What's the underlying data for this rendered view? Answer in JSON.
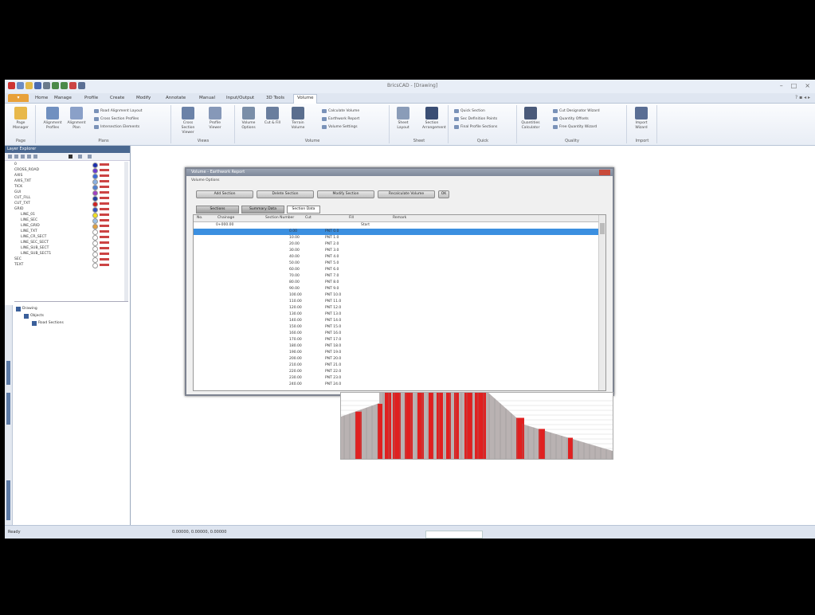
{
  "window": {
    "title": "BricsCAD - [Drawing]"
  },
  "ribbon_tabs": [
    {
      "label": "Home"
    },
    {
      "label": "Manage"
    },
    {
      "label": "Profile"
    },
    {
      "label": "Create"
    },
    {
      "label": "Modify"
    },
    {
      "label": "Annotate"
    },
    {
      "label": "Manual"
    },
    {
      "label": "Input/Output"
    },
    {
      "label": "3D Tools"
    },
    {
      "label": "Volume"
    }
  ],
  "ribbon_groups": [
    {
      "label": "Page",
      "buttons": [
        "Page Manager"
      ]
    },
    {
      "label": "Plans",
      "buttons": [
        "Alignment Profiles",
        "Alignment Plan",
        "Road Alignment Layout",
        "Cross Section Profiles",
        "Intersection Elements"
      ]
    },
    {
      "label": "Views",
      "buttons": [
        "Cross Section Viewer",
        "Profile Viewer"
      ]
    },
    {
      "label": "Volume",
      "buttons": [
        "Volume Options",
        "Cut & Fill",
        "Terrain Volume",
        "Calculate Volume",
        "Earthwork Report",
        "Volume Settings"
      ]
    },
    {
      "label": "Sheet",
      "buttons": [
        "Sheet Layout",
        "Section Arrangement"
      ]
    },
    {
      "label": "Quick",
      "buttons": [
        "Quick Section",
        "Sec Definition Points",
        "Final Profile Sections"
      ]
    },
    {
      "label": "Quality",
      "buttons": [
        "Quantities Calculator",
        "Cut Designator Wizard",
        "Quantity Offsets",
        "Free Quantity Wizard"
      ]
    },
    {
      "label": "Import",
      "buttons": [
        "Import Wizard"
      ]
    }
  ],
  "layer_panel": {
    "title": "Layer Explorer",
    "layers": [
      {
        "name": "0"
      },
      {
        "name": "CROSS_ROAD"
      },
      {
        "name": "AXIS"
      },
      {
        "name": "AXIS_TXT"
      },
      {
        "name": "TICK"
      },
      {
        "name": "GUI"
      },
      {
        "name": "CUT_FILL"
      },
      {
        "name": "CUT_TXT"
      },
      {
        "name": "GRID"
      },
      {
        "name": "LINE_01"
      },
      {
        "name": "LINE_SEC"
      },
      {
        "name": "LINE_GRID"
      },
      {
        "name": "LINE_TXT"
      },
      {
        "name": "LINE_CR_SECT"
      },
      {
        "name": "LINE_SEC_SECT"
      },
      {
        "name": "LINE_SUB_SECT"
      },
      {
        "name": "LINE_SUB_SECT1"
      },
      {
        "name": "SEC"
      },
      {
        "name": "TEXT"
      }
    ],
    "colors": [
      "#1a2fb0",
      "#6a3ad0",
      "#3a6ad8",
      "#8ab0e0",
      "#5080d0",
      "#a040c0",
      "#2040a0",
      "#d02020",
      "#3050c0",
      "#f0e020",
      "#9ac0e8",
      "#e0a040",
      "#ffffff",
      "#ffffff",
      "#ffffff",
      "#ffffff",
      "#ffffff",
      "#ffffff",
      "#ffffff"
    ],
    "tree": [
      {
        "label": "Drawing"
      },
      {
        "label": "Objects"
      },
      {
        "label": "Road Sections"
      }
    ]
  },
  "dialog": {
    "title": "Volume - Earthwork Report",
    "subtitle": "Volume Options",
    "buttons": [
      "Add Section",
      "Delete Section",
      "Modify Section",
      "Recalculate Volume",
      "OK"
    ],
    "tabs": [
      "Sections",
      "Summary Data",
      "Section Data"
    ],
    "columns": [
      "No.",
      "Chainage",
      "Section Number",
      "Cut",
      "Fill",
      "Remark"
    ],
    "first_row": {
      "station": "0+000.00",
      "remark": "Start"
    },
    "rows": [
      {
        "a": "0.00",
        "b": "PNT 0.0"
      },
      {
        "a": "10.00",
        "b": "PNT 1.0"
      },
      {
        "a": "20.00",
        "b": "PNT 2.0"
      },
      {
        "a": "30.00",
        "b": "PNT 3.0"
      },
      {
        "a": "40.00",
        "b": "PNT 4.0"
      },
      {
        "a": "50.00",
        "b": "PNT 5.0"
      },
      {
        "a": "60.00",
        "b": "PNT 6.0"
      },
      {
        "a": "70.00",
        "b": "PNT 7.0"
      },
      {
        "a": "80.00",
        "b": "PNT 8.0"
      },
      {
        "a": "90.00",
        "b": "PNT 9.0"
      },
      {
        "a": "100.00",
        "b": "PNT 10.0"
      },
      {
        "a": "110.00",
        "b": "PNT 11.0"
      },
      {
        "a": "120.00",
        "b": "PNT 12.0"
      },
      {
        "a": "130.00",
        "b": "PNT 13.0"
      },
      {
        "a": "140.00",
        "b": "PNT 14.0"
      },
      {
        "a": "150.00",
        "b": "PNT 15.0"
      },
      {
        "a": "160.00",
        "b": "PNT 16.0"
      },
      {
        "a": "170.00",
        "b": "PNT 17.0"
      },
      {
        "a": "180.00",
        "b": "PNT 18.0"
      },
      {
        "a": "190.00",
        "b": "PNT 19.0"
      },
      {
        "a": "200.00",
        "b": "PNT 20.0"
      },
      {
        "a": "210.00",
        "b": "PNT 21.0"
      },
      {
        "a": "220.00",
        "b": "PNT 22.0"
      },
      {
        "a": "230.00",
        "b": "PNT 23.0"
      },
      {
        "a": "240.00",
        "b": "PNT 24.0"
      }
    ],
    "selected_row": 0
  },
  "status": {
    "left": "Ready",
    "center": "0.00000, 0.00000, 0.00000"
  },
  "colors": {
    "ribbon": "#e8eef7",
    "selection": "#3b8fe0",
    "profile_fill": "#e02020",
    "profile_ground": "#b9b2b2",
    "file_tab": "#e8a13a"
  }
}
